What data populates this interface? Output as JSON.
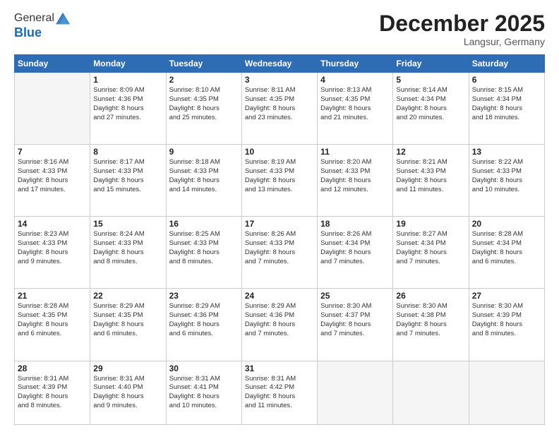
{
  "header": {
    "logo_line1": "General",
    "logo_line2": "Blue",
    "month": "December 2025",
    "location": "Langsur, Germany"
  },
  "weekdays": [
    "Sunday",
    "Monday",
    "Tuesday",
    "Wednesday",
    "Thursday",
    "Friday",
    "Saturday"
  ],
  "weeks": [
    [
      {
        "day": "",
        "sunrise": "",
        "sunset": "",
        "daylight": "",
        "empty": true
      },
      {
        "day": "1",
        "sunrise": "Sunrise: 8:09 AM",
        "sunset": "Sunset: 4:36 PM",
        "daylight": "Daylight: 8 hours",
        "daylight2": "and 27 minutes."
      },
      {
        "day": "2",
        "sunrise": "Sunrise: 8:10 AM",
        "sunset": "Sunset: 4:35 PM",
        "daylight": "Daylight: 8 hours",
        "daylight2": "and 25 minutes."
      },
      {
        "day": "3",
        "sunrise": "Sunrise: 8:11 AM",
        "sunset": "Sunset: 4:35 PM",
        "daylight": "Daylight: 8 hours",
        "daylight2": "and 23 minutes."
      },
      {
        "day": "4",
        "sunrise": "Sunrise: 8:13 AM",
        "sunset": "Sunset: 4:35 PM",
        "daylight": "Daylight: 8 hours",
        "daylight2": "and 21 minutes."
      },
      {
        "day": "5",
        "sunrise": "Sunrise: 8:14 AM",
        "sunset": "Sunset: 4:34 PM",
        "daylight": "Daylight: 8 hours",
        "daylight2": "and 20 minutes."
      },
      {
        "day": "6",
        "sunrise": "Sunrise: 8:15 AM",
        "sunset": "Sunset: 4:34 PM",
        "daylight": "Daylight: 8 hours",
        "daylight2": "and 18 minutes."
      }
    ],
    [
      {
        "day": "7",
        "sunrise": "Sunrise: 8:16 AM",
        "sunset": "Sunset: 4:33 PM",
        "daylight": "Daylight: 8 hours",
        "daylight2": "and 17 minutes."
      },
      {
        "day": "8",
        "sunrise": "Sunrise: 8:17 AM",
        "sunset": "Sunset: 4:33 PM",
        "daylight": "Daylight: 8 hours",
        "daylight2": "and 15 minutes."
      },
      {
        "day": "9",
        "sunrise": "Sunrise: 8:18 AM",
        "sunset": "Sunset: 4:33 PM",
        "daylight": "Daylight: 8 hours",
        "daylight2": "and 14 minutes."
      },
      {
        "day": "10",
        "sunrise": "Sunrise: 8:19 AM",
        "sunset": "Sunset: 4:33 PM",
        "daylight": "Daylight: 8 hours",
        "daylight2": "and 13 minutes."
      },
      {
        "day": "11",
        "sunrise": "Sunrise: 8:20 AM",
        "sunset": "Sunset: 4:33 PM",
        "daylight": "Daylight: 8 hours",
        "daylight2": "and 12 minutes."
      },
      {
        "day": "12",
        "sunrise": "Sunrise: 8:21 AM",
        "sunset": "Sunset: 4:33 PM",
        "daylight": "Daylight: 8 hours",
        "daylight2": "and 11 minutes."
      },
      {
        "day": "13",
        "sunrise": "Sunrise: 8:22 AM",
        "sunset": "Sunset: 4:33 PM",
        "daylight": "Daylight: 8 hours",
        "daylight2": "and 10 minutes."
      }
    ],
    [
      {
        "day": "14",
        "sunrise": "Sunrise: 8:23 AM",
        "sunset": "Sunset: 4:33 PM",
        "daylight": "Daylight: 8 hours",
        "daylight2": "and 9 minutes."
      },
      {
        "day": "15",
        "sunrise": "Sunrise: 8:24 AM",
        "sunset": "Sunset: 4:33 PM",
        "daylight": "Daylight: 8 hours",
        "daylight2": "and 8 minutes."
      },
      {
        "day": "16",
        "sunrise": "Sunrise: 8:25 AM",
        "sunset": "Sunset: 4:33 PM",
        "daylight": "Daylight: 8 hours",
        "daylight2": "and 8 minutes."
      },
      {
        "day": "17",
        "sunrise": "Sunrise: 8:26 AM",
        "sunset": "Sunset: 4:33 PM",
        "daylight": "Daylight: 8 hours",
        "daylight2": "and 7 minutes."
      },
      {
        "day": "18",
        "sunrise": "Sunrise: 8:26 AM",
        "sunset": "Sunset: 4:34 PM",
        "daylight": "Daylight: 8 hours",
        "daylight2": "and 7 minutes."
      },
      {
        "day": "19",
        "sunrise": "Sunrise: 8:27 AM",
        "sunset": "Sunset: 4:34 PM",
        "daylight": "Daylight: 8 hours",
        "daylight2": "and 7 minutes."
      },
      {
        "day": "20",
        "sunrise": "Sunrise: 8:28 AM",
        "sunset": "Sunset: 4:34 PM",
        "daylight": "Daylight: 8 hours",
        "daylight2": "and 6 minutes."
      }
    ],
    [
      {
        "day": "21",
        "sunrise": "Sunrise: 8:28 AM",
        "sunset": "Sunset: 4:35 PM",
        "daylight": "Daylight: 8 hours",
        "daylight2": "and 6 minutes."
      },
      {
        "day": "22",
        "sunrise": "Sunrise: 8:29 AM",
        "sunset": "Sunset: 4:35 PM",
        "daylight": "Daylight: 8 hours",
        "daylight2": "and 6 minutes."
      },
      {
        "day": "23",
        "sunrise": "Sunrise: 8:29 AM",
        "sunset": "Sunset: 4:36 PM",
        "daylight": "Daylight: 8 hours",
        "daylight2": "and 6 minutes."
      },
      {
        "day": "24",
        "sunrise": "Sunrise: 8:29 AM",
        "sunset": "Sunset: 4:36 PM",
        "daylight": "Daylight: 8 hours",
        "daylight2": "and 7 minutes."
      },
      {
        "day": "25",
        "sunrise": "Sunrise: 8:30 AM",
        "sunset": "Sunset: 4:37 PM",
        "daylight": "Daylight: 8 hours",
        "daylight2": "and 7 minutes."
      },
      {
        "day": "26",
        "sunrise": "Sunrise: 8:30 AM",
        "sunset": "Sunset: 4:38 PM",
        "daylight": "Daylight: 8 hours",
        "daylight2": "and 7 minutes."
      },
      {
        "day": "27",
        "sunrise": "Sunrise: 8:30 AM",
        "sunset": "Sunset: 4:39 PM",
        "daylight": "Daylight: 8 hours",
        "daylight2": "and 8 minutes."
      }
    ],
    [
      {
        "day": "28",
        "sunrise": "Sunrise: 8:31 AM",
        "sunset": "Sunset: 4:39 PM",
        "daylight": "Daylight: 8 hours",
        "daylight2": "and 8 minutes."
      },
      {
        "day": "29",
        "sunrise": "Sunrise: 8:31 AM",
        "sunset": "Sunset: 4:40 PM",
        "daylight": "Daylight: 8 hours",
        "daylight2": "and 9 minutes."
      },
      {
        "day": "30",
        "sunrise": "Sunrise: 8:31 AM",
        "sunset": "Sunset: 4:41 PM",
        "daylight": "Daylight: 8 hours",
        "daylight2": "and 10 minutes."
      },
      {
        "day": "31",
        "sunrise": "Sunrise: 8:31 AM",
        "sunset": "Sunset: 4:42 PM",
        "daylight": "Daylight: 8 hours",
        "daylight2": "and 11 minutes."
      },
      {
        "day": "",
        "sunrise": "",
        "sunset": "",
        "daylight": "",
        "daylight2": "",
        "empty": true
      },
      {
        "day": "",
        "sunrise": "",
        "sunset": "",
        "daylight": "",
        "daylight2": "",
        "empty": true
      },
      {
        "day": "",
        "sunrise": "",
        "sunset": "",
        "daylight": "",
        "daylight2": "",
        "empty": true
      }
    ]
  ]
}
